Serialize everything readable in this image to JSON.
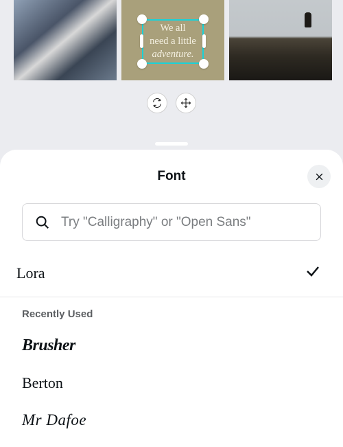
{
  "canvas": {
    "text_line1": "We all",
    "text_line2": "need a little",
    "text_line3": "adventure."
  },
  "sheet": {
    "title": "Font"
  },
  "search": {
    "placeholder": "Try \"Calligraphy\" or \"Open Sans\""
  },
  "selected_font": "Lora",
  "section_recent": "Recently Used",
  "recent_fonts": {
    "0": "Brusher",
    "1": "Berton",
    "2": "Mr Dafoe"
  }
}
